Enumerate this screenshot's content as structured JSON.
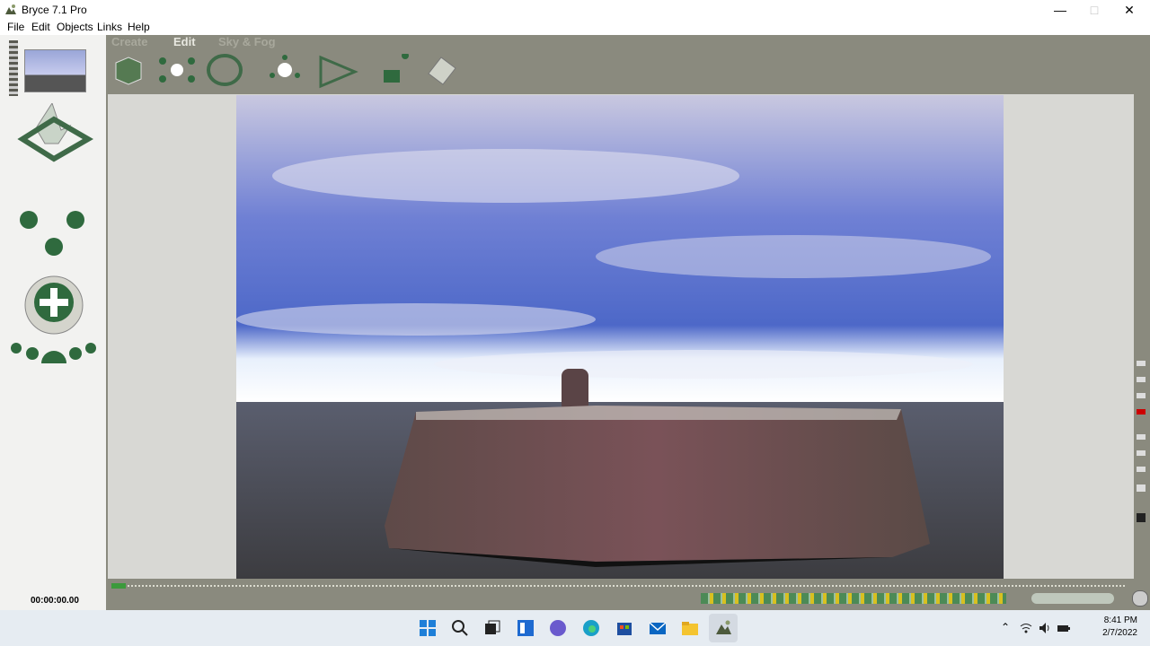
{
  "window": {
    "title": "Bryce 7.1  Pro"
  },
  "menu": {
    "items": [
      "File",
      "Edit",
      "Objects",
      "Links",
      "Help"
    ]
  },
  "modes": {
    "create": "Create",
    "edit": "Edit",
    "sky": "Sky & Fog"
  },
  "timeline": {
    "timecode": "00:00:00.00"
  },
  "taskbar": {
    "time": "8:41 PM",
    "date": "2/7/2022"
  },
  "colors": {
    "accent_green": "#3f7a4a",
    "panel": "#8a8a7e",
    "sky": "#7f8fd8",
    "rock": "#6a4a4c"
  }
}
